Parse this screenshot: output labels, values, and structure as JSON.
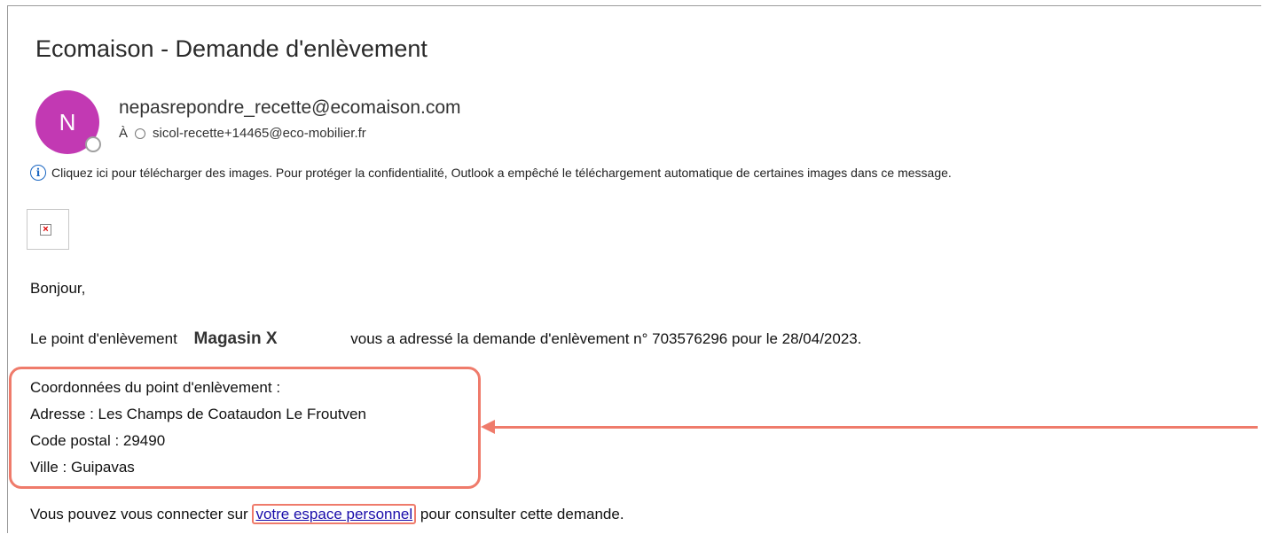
{
  "email": {
    "subject": "Ecomaison - Demande d'enlèvement",
    "avatar_initial": "N",
    "sender": "nepasrepondre_recette@ecomaison.com",
    "to_label": "À",
    "recipient": "sicol-recette+14465@eco-mobilier.fr",
    "info_icon": "i",
    "info_message": "Cliquez ici pour télécharger des images. Pour protéger la confidentialité, Outlook a empêché le téléchargement automatique de certaines images dans ce message."
  },
  "body": {
    "greeting": "Bonjour,",
    "line1_prefix": "Le point d'enlèvement",
    "store_name": "Magasin X",
    "line1_suffix": "vous a adressé la demande d'enlèvement n° 703576296 pour le 28/04/2023.",
    "coord_title": "Coordonnées du point d'enlèvement :",
    "address": "Adresse : Les Champs de Coataudon Le Froutven",
    "postal_code": "Code postal : 29490",
    "city": "Ville : Guipavas",
    "last_prefix": "Vous pouvez vous connecter sur",
    "link_text": "votre espace personnel",
    "last_suffix": "pour consulter cette demande."
  },
  "annotation_color": "#ef7b6b",
  "accent_color": "#c239b3"
}
